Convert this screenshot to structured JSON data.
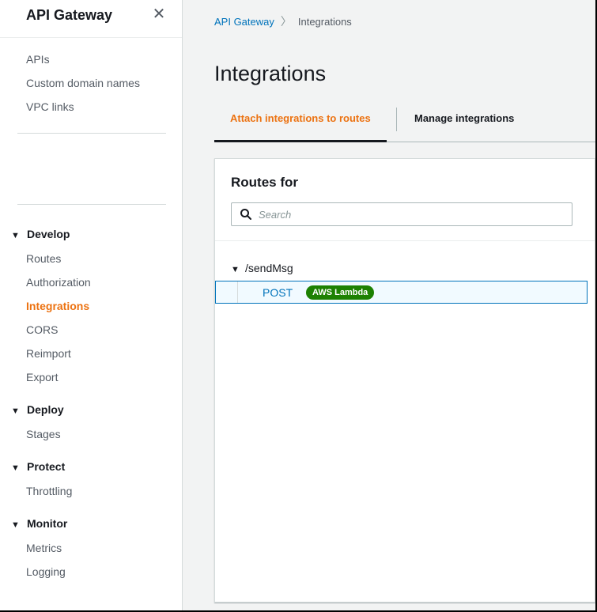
{
  "sidebar": {
    "title": "API Gateway",
    "close_symbol": "✕",
    "top_links": [
      {
        "label": "APIs"
      },
      {
        "label": "Custom domain names"
      },
      {
        "label": "VPC links"
      }
    ],
    "sections": {
      "develop": {
        "label": "Develop",
        "items": [
          {
            "label": "Routes"
          },
          {
            "label": "Authorization"
          },
          {
            "label": "Integrations"
          },
          {
            "label": "CORS"
          },
          {
            "label": "Reimport"
          },
          {
            "label": "Export"
          }
        ]
      },
      "deploy": {
        "label": "Deploy",
        "items": [
          {
            "label": "Stages"
          }
        ]
      },
      "protect": {
        "label": "Protect",
        "items": [
          {
            "label": "Throttling"
          }
        ]
      },
      "monitor": {
        "label": "Monitor",
        "items": [
          {
            "label": "Metrics"
          },
          {
            "label": "Logging"
          }
        ]
      }
    },
    "active_item": "Integrations"
  },
  "breadcrumb": {
    "root": "API Gateway",
    "current": "Integrations"
  },
  "page": {
    "title": "Integrations",
    "tabs": [
      {
        "label": "Attach integrations to routes",
        "active": true
      },
      {
        "label": "Manage integrations",
        "active": false
      }
    ]
  },
  "panel": {
    "title": "Routes for",
    "search_placeholder": "Search",
    "tree": {
      "path": "/sendMsg",
      "routes": [
        {
          "method": "POST",
          "integration": "AWS Lambda"
        }
      ]
    }
  },
  "icons": {
    "close": "close-icon",
    "search": "search-icon",
    "expand": "caret-down-icon",
    "breadcrumb_separator": "chevron-right-icon"
  },
  "colors": {
    "accent": "#ec7211",
    "link": "#0073bb",
    "badge": "#1d8102",
    "selected_row_bg": "#f1faff"
  }
}
